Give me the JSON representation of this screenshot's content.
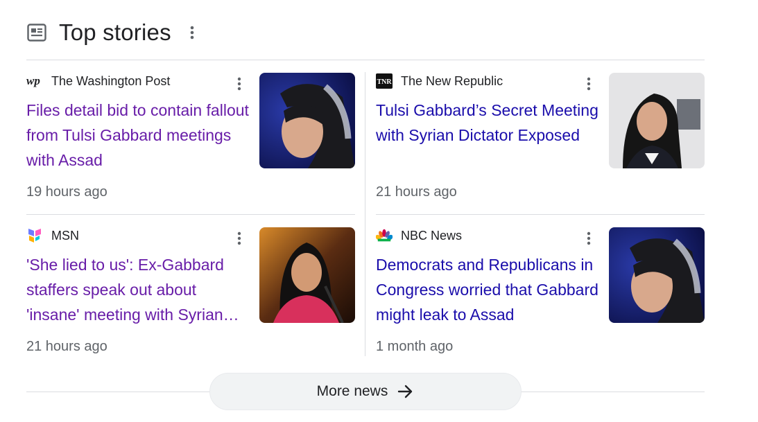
{
  "header": {
    "title": "Top stories",
    "icon": "newspaper-icon",
    "menu_icon": "more-vert-icon"
  },
  "stories": [
    {
      "source": "The Washington Post",
      "logo": "washington-post-logo",
      "headline": "Files detail bid to contain fallout from Tulsi Gabbard meetings with Assad",
      "time": "19 hours ago",
      "visited": true,
      "thumbnail": "portrait-dark-blue-background"
    },
    {
      "source": "The New Republic",
      "logo": "new-republic-logo",
      "logo_text": "TNR",
      "headline": "Tulsi Gabbard’s Secret Meeting with Syrian Dictator Exposed",
      "time": "21 hours ago",
      "visited": false,
      "thumbnail": "portrait-light-background"
    },
    {
      "source": "MSN",
      "logo": "msn-logo",
      "headline": "'She lied to us': Ex-Gabbard staffers speak out about 'insane' meeting with Syrian dictator",
      "time": "21 hours ago",
      "visited": true,
      "thumbnail": "speaker-at-microphone"
    },
    {
      "source": "NBC News",
      "logo": "nbc-peacock-logo",
      "headline": "Democrats and Republicans in Congress worried that Gabbard might leak to Assad",
      "time": "1 month ago",
      "visited": false,
      "thumbnail": "portrait-dark-blue-background"
    }
  ],
  "more_news": {
    "label": "More news",
    "icon": "arrow-right-icon"
  },
  "colors": {
    "visited_link": "#681da8",
    "link": "#1a0dab",
    "meta_text": "#5f6368",
    "divider": "#dadce0",
    "button_bg": "#f1f3f4"
  }
}
